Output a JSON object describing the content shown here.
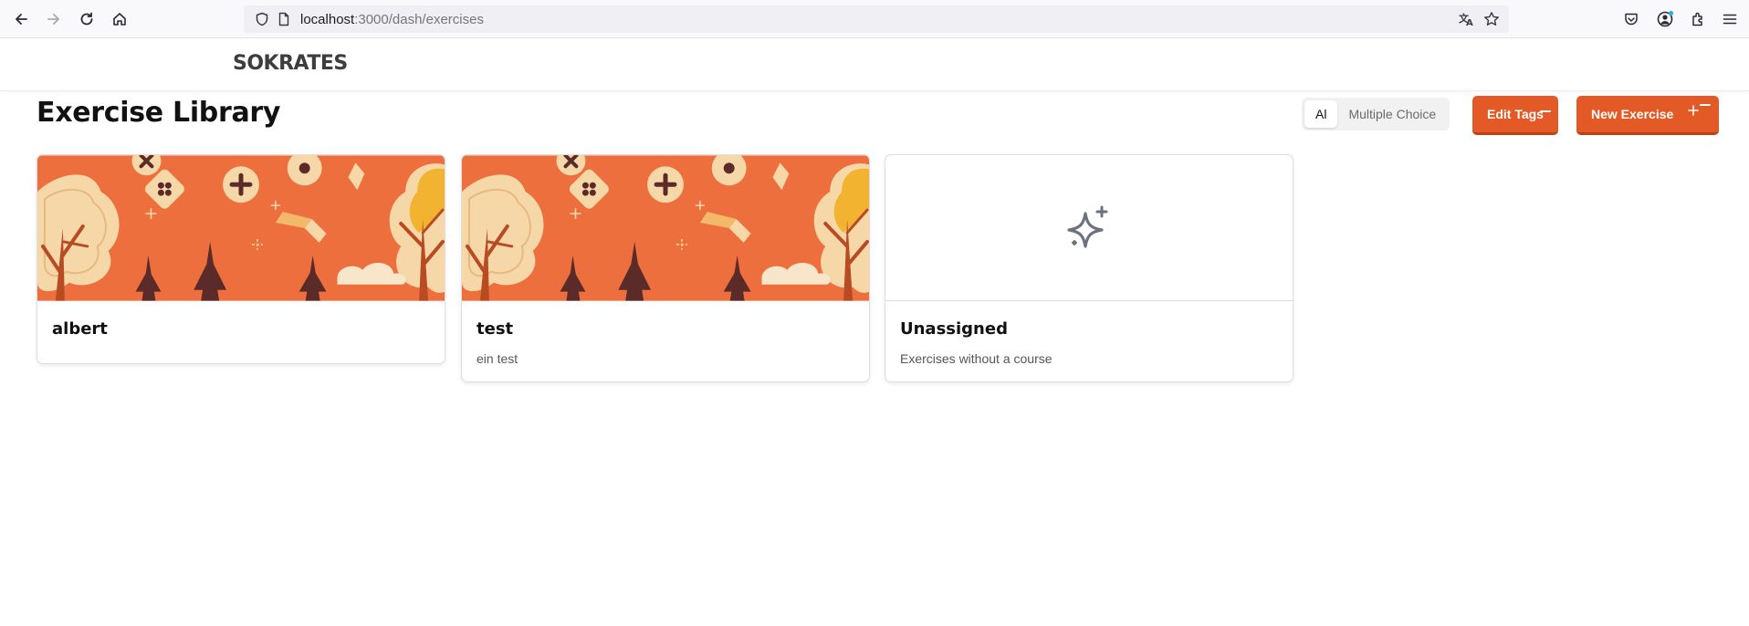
{
  "browser": {
    "url_host": "localhost",
    "url_path": ":3000/dash/exercises",
    "icons": [
      "back-arrow-icon",
      "forward-arrow-icon",
      "reload-icon",
      "home-icon",
      "shield-icon",
      "page-icon",
      "translate-icon",
      "star-icon",
      "pocket-icon",
      "account-icon",
      "extensions-icon",
      "menu-icon"
    ]
  },
  "header": {
    "logo": "SOKRATES"
  },
  "page": {
    "title": "Exercise Library"
  },
  "filter": {
    "options": [
      {
        "label": "Al",
        "active": true
      },
      {
        "label": "Multiple Choice",
        "active": false
      }
    ]
  },
  "actions": {
    "edit_tags": "Edit Tags",
    "new_exercise": "New Exercise",
    "accent_color": "#e35a26"
  },
  "cards": [
    {
      "title": "albert",
      "description": "",
      "image": "autumn-illustration"
    },
    {
      "title": "test",
      "description": "ein test",
      "image": "autumn-illustration"
    },
    {
      "title": "Unassigned",
      "description": "Exercises without a course",
      "image": "sparkle-icon"
    }
  ]
}
